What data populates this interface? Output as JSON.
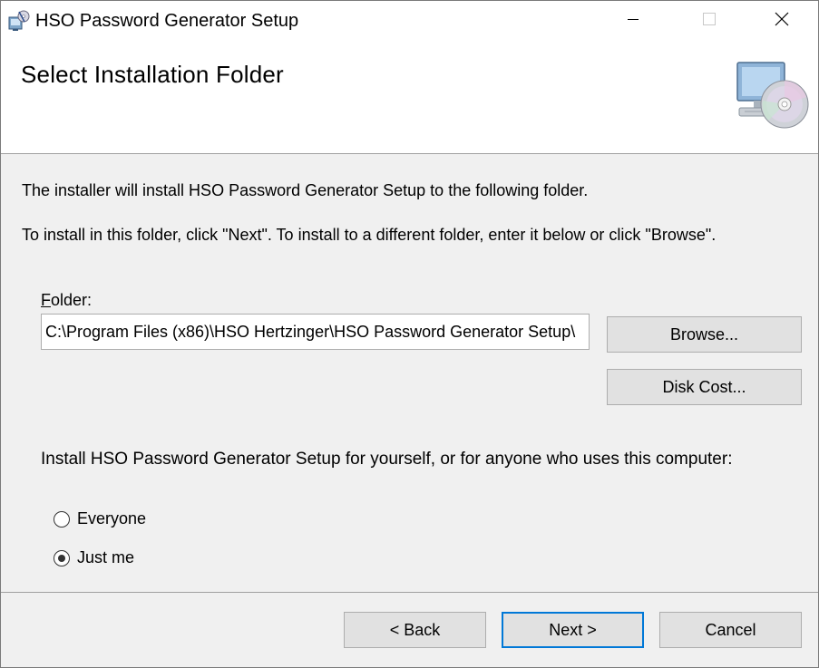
{
  "window": {
    "title": "HSO Password Generator Setup",
    "controls": {
      "minimize": "minimize",
      "maximize": "maximize",
      "close": "close"
    }
  },
  "header": {
    "title": "Select Installation Folder",
    "graphic_icon": "computer-cd-icon"
  },
  "body": {
    "intro": "The installer will install HSO Password Generator Setup to the following folder.",
    "instructions": "To install in this folder, click \"Next\". To install to a different folder, enter it below or click \"Browse\".",
    "folder_label_prefix": "F",
    "folder_label_rest": "older:",
    "folder_value": "C:\\Program Files (x86)\\HSO Hertzinger\\HSO Password Generator Setup\\",
    "browse_label": "Browse...",
    "disk_cost_label": "Disk Cost...",
    "scope_question": "Install HSO Password Generator Setup for yourself, or for anyone who uses this computer:",
    "options": [
      {
        "label": "Everyone",
        "checked": false
      },
      {
        "label": "Just me",
        "checked": true
      }
    ]
  },
  "footer": {
    "back_label": "< Back",
    "next_label": "Next >",
    "cancel_label": "Cancel"
  },
  "colors": {
    "focus_border": "#0078d7",
    "dialog_bg": "#f0f0f0",
    "button_bg": "#e1e1e1"
  }
}
